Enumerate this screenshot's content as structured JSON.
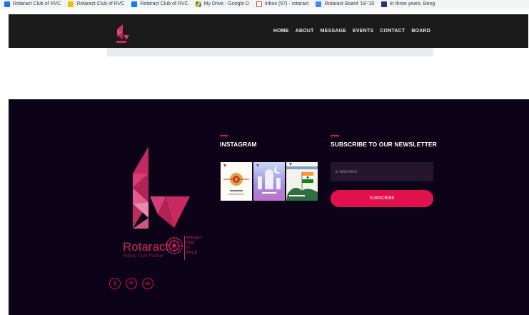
{
  "colors": {
    "accent": "#e1114d",
    "footer_bg": "#0d0318",
    "nav_bg": "#1b1b1b",
    "logo_pink": "#c9295f"
  },
  "bookmarks": [
    {
      "label": "Rotaract Club of RVC",
      "icon": "web-icon"
    },
    {
      "label": "Rotaract Club of RVC",
      "icon": "bookmark-icon"
    },
    {
      "label": "Rotaract Club of RVC",
      "icon": "facebook-icon"
    },
    {
      "label": "My Drive - Google D",
      "icon": "google-drive-icon"
    },
    {
      "label": "Inbox (57) - rotaract",
      "icon": "gmail-icon"
    },
    {
      "label": "Rotaract Board '18-'19",
      "icon": "docs-icon"
    },
    {
      "label": "In three years, Beng",
      "icon": "news-icon"
    }
  ],
  "nav": {
    "links": [
      "HOME",
      "ABOUT",
      "MESSAGE",
      "EVENTS",
      "CONTACT",
      "BOARD"
    ]
  },
  "footer": {
    "brand": {
      "name": "Rotaract",
      "tagline": "Rotary Club Partner",
      "club_lines": [
        "Rotaract",
        "Club",
        "of",
        "RVCE"
      ]
    },
    "social": [
      {
        "icon": "facebook-icon",
        "glyph": "f"
      },
      {
        "icon": "linkedin-icon",
        "glyph": "in"
      },
      {
        "icon": "email-icon",
        "glyph": "✉"
      }
    ],
    "instagram": {
      "title": "INSTAGRAM",
      "posts": [
        {
          "caption": "Happy Raksha Bandhan"
        },
        {
          "caption": "Eid Mubarak"
        },
        {
          "caption": "Independence Day"
        }
      ]
    },
    "newsletter": {
      "title": "SUBSCRIBE TO OUR NEWSLETTER",
      "email_placeholder": "E-Mail here",
      "button_label": "SUBSCRIBE"
    }
  }
}
